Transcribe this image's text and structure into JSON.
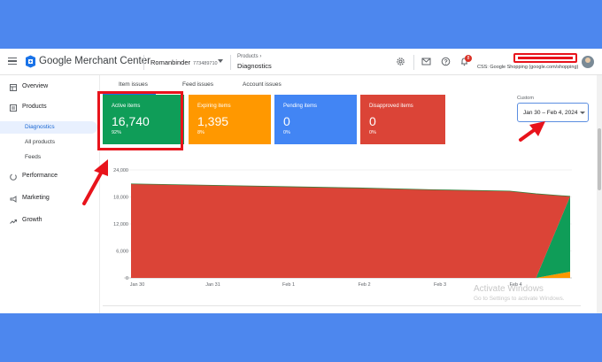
{
  "app": {
    "title": "Google Merchant Center"
  },
  "account": {
    "name": "Romanbinder",
    "id": "773489710",
    "subtitle": "CSS: Google Shopping (google.com/shopping)",
    "notifications": "8"
  },
  "breadcrumb": {
    "parent": "Products",
    "current": "Diagnostics"
  },
  "sidebar": {
    "items": [
      {
        "label": "Overview",
        "icon": "overview-icon"
      },
      {
        "label": "Products",
        "icon": "products-icon"
      },
      {
        "label": "Diagnostics"
      },
      {
        "label": "All products"
      },
      {
        "label": "Feeds"
      },
      {
        "label": "Performance",
        "icon": "performance-icon"
      },
      {
        "label": "Marketing",
        "icon": "marketing-icon"
      },
      {
        "label": "Growth",
        "icon": "growth-icon"
      }
    ]
  },
  "tabs": [
    {
      "label": "Item issues",
      "active": true
    },
    {
      "label": "Feed issues"
    },
    {
      "label": "Account issues"
    }
  ],
  "cards": [
    {
      "label": "Active items",
      "value": "16,740",
      "pct": "92%",
      "color": "#0f9d58"
    },
    {
      "label": "Expiring items",
      "value": "1,395",
      "pct": "8%",
      "color": "#ff9800"
    },
    {
      "label": "Pending items",
      "value": "0",
      "pct": "0%",
      "color": "#4285f4"
    },
    {
      "label": "Disapproved items",
      "value": "0",
      "pct": "0%",
      "color": "#db4437"
    }
  ],
  "date_range": {
    "label": "Custom",
    "value": "Jan 30 – Feb 4, 2024"
  },
  "watermark": {
    "title": "Activate Windows",
    "subtitle": "Go to Settings to activate Windows."
  },
  "chart_data": {
    "type": "area",
    "x_tick_labels": [
      "Jan 30",
      "Jan 31",
      "Feb 1",
      "Feb 2",
      "Feb 3",
      "Feb 4"
    ],
    "y_tick_labels": [
      "0",
      "6,000",
      "12,000",
      "18,000",
      "24,000"
    ],
    "ylim": [
      0,
      24000
    ],
    "xlim": [
      0,
      5.8
    ],
    "x": [
      0,
      1,
      2,
      3,
      4,
      5,
      5.35,
      5.8
    ],
    "series": [
      {
        "name": "Disapproved items",
        "color": "#db4437",
        "values": [
          20900,
          20600,
          20300,
          20000,
          19600,
          19300,
          18700,
          0
        ]
      },
      {
        "name": "Active items",
        "color": "#0f9d58",
        "values": [
          0,
          0,
          0,
          0,
          0,
          0,
          0,
          16740
        ]
      },
      {
        "name": "Expiring items",
        "color": "#ff9800",
        "values": [
          0,
          0,
          0,
          0,
          0,
          0,
          0,
          1395
        ]
      }
    ]
  }
}
